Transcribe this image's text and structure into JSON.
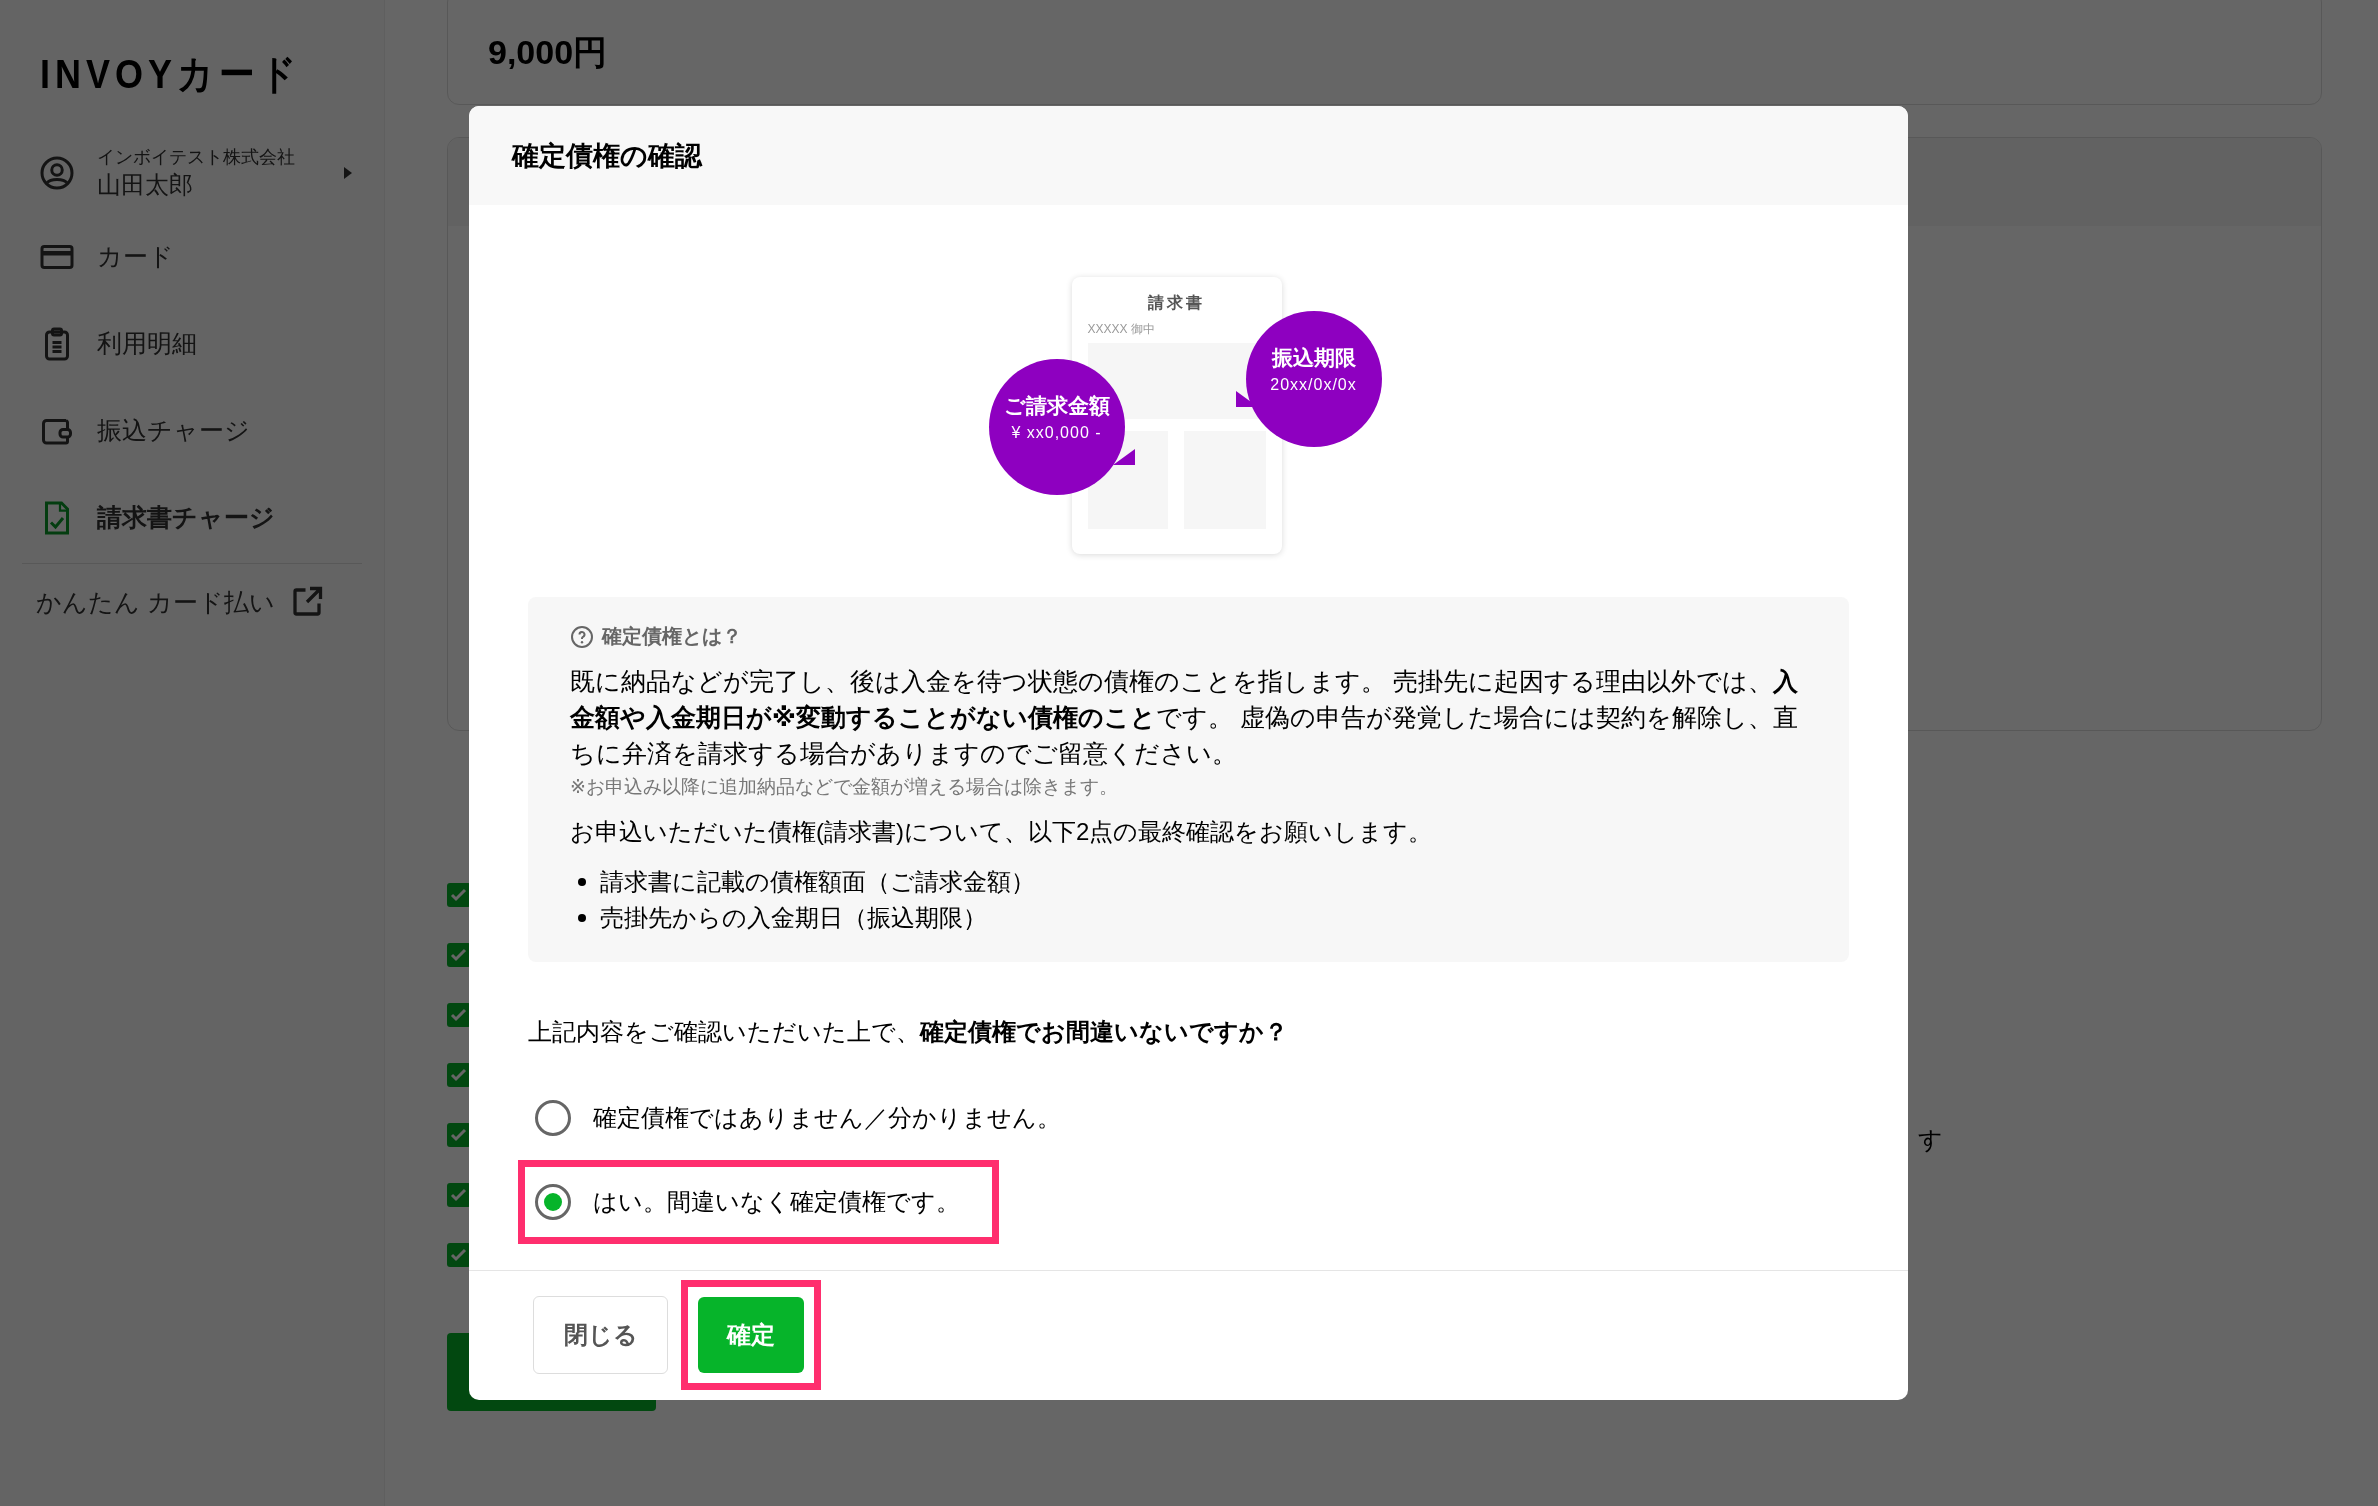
{
  "sidebar": {
    "logo": "INVOYカード",
    "account": {
      "company": "インボイテスト株式会社",
      "name": "山田太郎"
    },
    "items": [
      {
        "label": "カード",
        "kind": "card",
        "selected": false
      },
      {
        "label": "利用明細",
        "kind": "statement",
        "selected": false
      },
      {
        "label": "振込チャージ",
        "kind": "transfer",
        "selected": false
      },
      {
        "label": "請求書チャージ",
        "kind": "invoice",
        "selected": true
      }
    ],
    "external_link": "かんたん カード払い"
  },
  "page": {
    "amount": "9,000円",
    "checks": [
      {
        "checked": true
      },
      {
        "checked": true
      },
      {
        "checked": true
      },
      {
        "checked": true
      },
      {
        "checked": true
      },
      {
        "checked": true
      },
      {
        "checked": true
      }
    ],
    "trailing_text": "す"
  },
  "modal": {
    "title": "確定債権の確認",
    "illustration": {
      "doc_title": "請求書",
      "addressee": "XXXXX 御中",
      "amount_label": "ご請求金額",
      "amount_value": "¥ xx0,000 -",
      "deadline_label": "振込期限",
      "deadline_value": "20xx/0x/0x"
    },
    "info": {
      "heading": "確定債権とは？",
      "paragraph": "既に納品などが完了し、後は入金を待つ状態の債権のことを指します。 売掛先に起因する理由以外では、**入金額や入金期日が※変動することがない債権のこと**です。 虚偽の申告が発覚した場合には契約を解除し、直ちに弁済を請求する場合がありますのでご留意ください。",
      "note": "※お申込み以降に追加納品などで金額が増える場合は除きます。",
      "lead": "お申込いただいた債権(請求書)について、以下2点の最終確認をお願いします。",
      "bullets": [
        "請求書に記載の債権額面（ご請求金額）",
        "売掛先からの入金期日（振込期限）"
      ]
    },
    "question": "上記内容をご確認いただいた上で、**確定債権でお間違いないですか？**",
    "options": [
      {
        "label": "確定債権ではありません／分かりません。",
        "selected": false,
        "highlighted": false
      },
      {
        "label": "はい。間違いなく確定債権です。",
        "selected": true,
        "highlighted": true
      }
    ],
    "buttons": [
      {
        "label": "閉じる",
        "kind": "secondary",
        "highlighted": false
      },
      {
        "label": "確定",
        "kind": "primary",
        "highlighted": true
      }
    ]
  }
}
